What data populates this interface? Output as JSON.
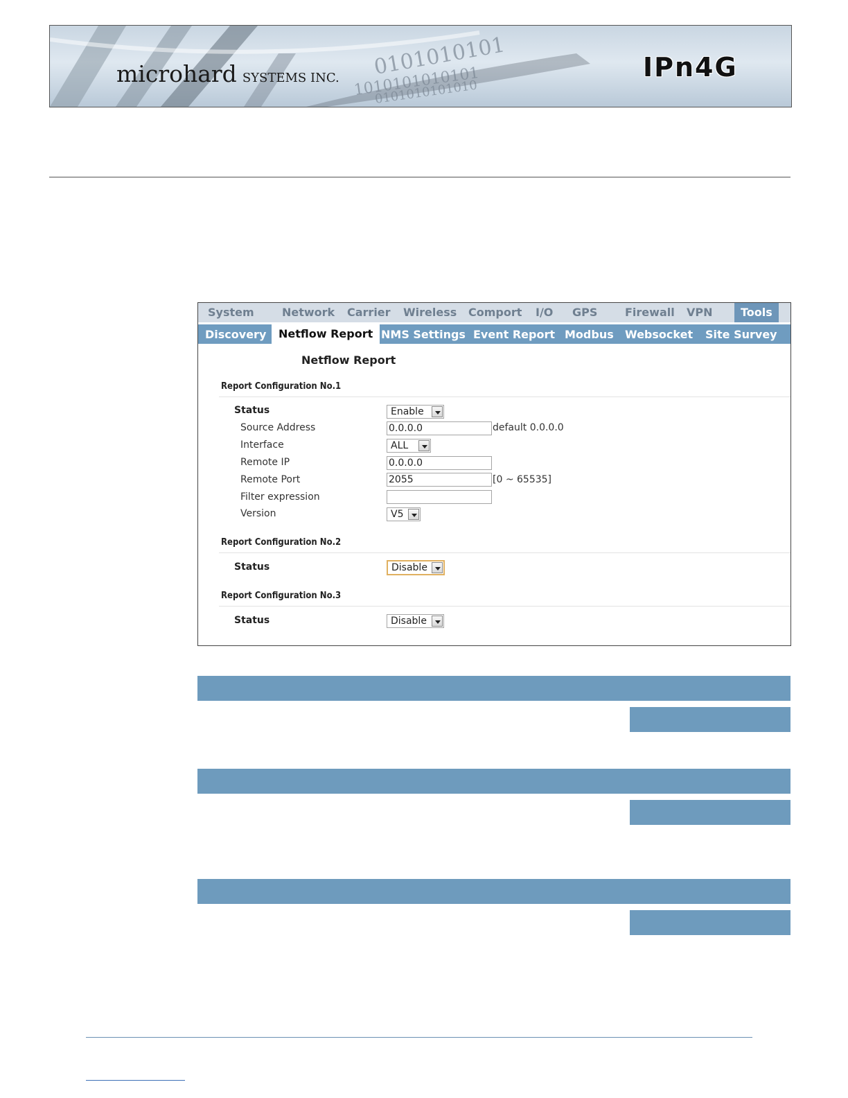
{
  "header": {
    "brand_name": "microhard",
    "brand_suffix": "SYSTEMS INC.",
    "product": "IPn4G"
  },
  "screenshot": {
    "top_nav": [
      {
        "label": "System"
      },
      {
        "label": "Network"
      },
      {
        "label": "Carrier"
      },
      {
        "label": "Wireless"
      },
      {
        "label": "Comport"
      },
      {
        "label": "I/O"
      },
      {
        "label": "GPS"
      },
      {
        "label": "Firewall"
      },
      {
        "label": "VPN"
      },
      {
        "label": "Tools",
        "active": true
      }
    ],
    "sub_nav": [
      {
        "label": "Discovery"
      },
      {
        "label": "Netflow Report",
        "active": true
      },
      {
        "label": "NMS Settings"
      },
      {
        "label": "Event Report"
      },
      {
        "label": "Modbus"
      },
      {
        "label": "Websocket"
      },
      {
        "label": "Site Survey"
      }
    ],
    "page_title": "Netflow Report",
    "sections": [
      {
        "heading": "Report Configuration No.1",
        "status_label": "Status",
        "status_value": "Enable",
        "fields": {
          "source_address": {
            "label": "Source Address",
            "value": "0.0.0.0",
            "hint": "default 0.0.0.0"
          },
          "interface": {
            "label": "Interface",
            "value": "ALL"
          },
          "remote_ip": {
            "label": "Remote IP",
            "value": "0.0.0.0"
          },
          "remote_port": {
            "label": "Remote Port",
            "value": "2055",
            "hint": "[0 ~ 65535]"
          },
          "filter_expression": {
            "label": "Filter expression",
            "value": ""
          },
          "version": {
            "label": "Version",
            "value": "V5"
          }
        }
      },
      {
        "heading": "Report Configuration No.2",
        "status_label": "Status",
        "status_value": "Disable"
      },
      {
        "heading": "Report Configuration No.3",
        "status_label": "Status",
        "status_value": "Disable"
      }
    ]
  },
  "colors": {
    "bar_blue": "#6e9bbd",
    "subnav_blue": "#6f9cc0",
    "topnav_gray": "#d5dde6"
  }
}
